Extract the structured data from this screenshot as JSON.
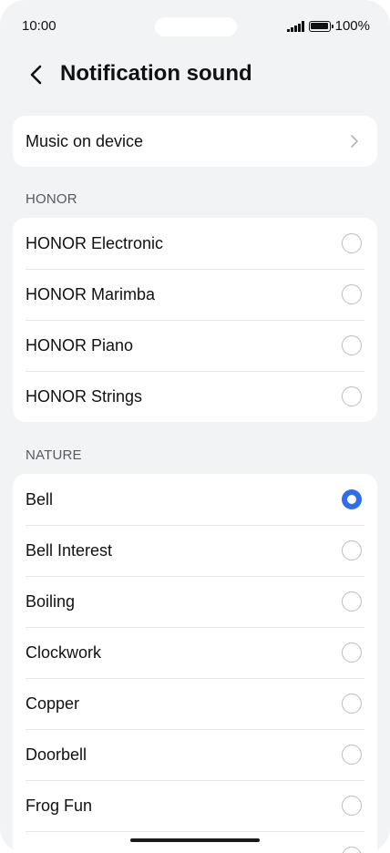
{
  "status_bar": {
    "time": "10:00",
    "battery_text": "100%",
    "signal_icon": "signal-icon",
    "battery_icon": "battery-icon"
  },
  "header": {
    "title": "Notification sound",
    "back_icon": "chevron-left-icon"
  },
  "music_on_device": {
    "label": "Music on device",
    "icon": "chevron-right-icon"
  },
  "sections": [
    {
      "label": "HONOR",
      "items": [
        {
          "label": "HONOR Electronic",
          "selected": false
        },
        {
          "label": "HONOR Marimba",
          "selected": false
        },
        {
          "label": "HONOR Piano",
          "selected": false
        },
        {
          "label": "HONOR Strings",
          "selected": false
        }
      ]
    },
    {
      "label": "NATURE",
      "items": [
        {
          "label": "Bell",
          "selected": true
        },
        {
          "label": "Bell Interest",
          "selected": false
        },
        {
          "label": "Boiling",
          "selected": false
        },
        {
          "label": "Clockwork",
          "selected": false
        },
        {
          "label": "Copper",
          "selected": false
        },
        {
          "label": "Doorbell",
          "selected": false
        },
        {
          "label": "Frog Fun",
          "selected": false
        }
      ]
    }
  ],
  "colors": {
    "accent": "#2f6ee6",
    "background": "#f1f3f5",
    "card": "#ffffff"
  }
}
